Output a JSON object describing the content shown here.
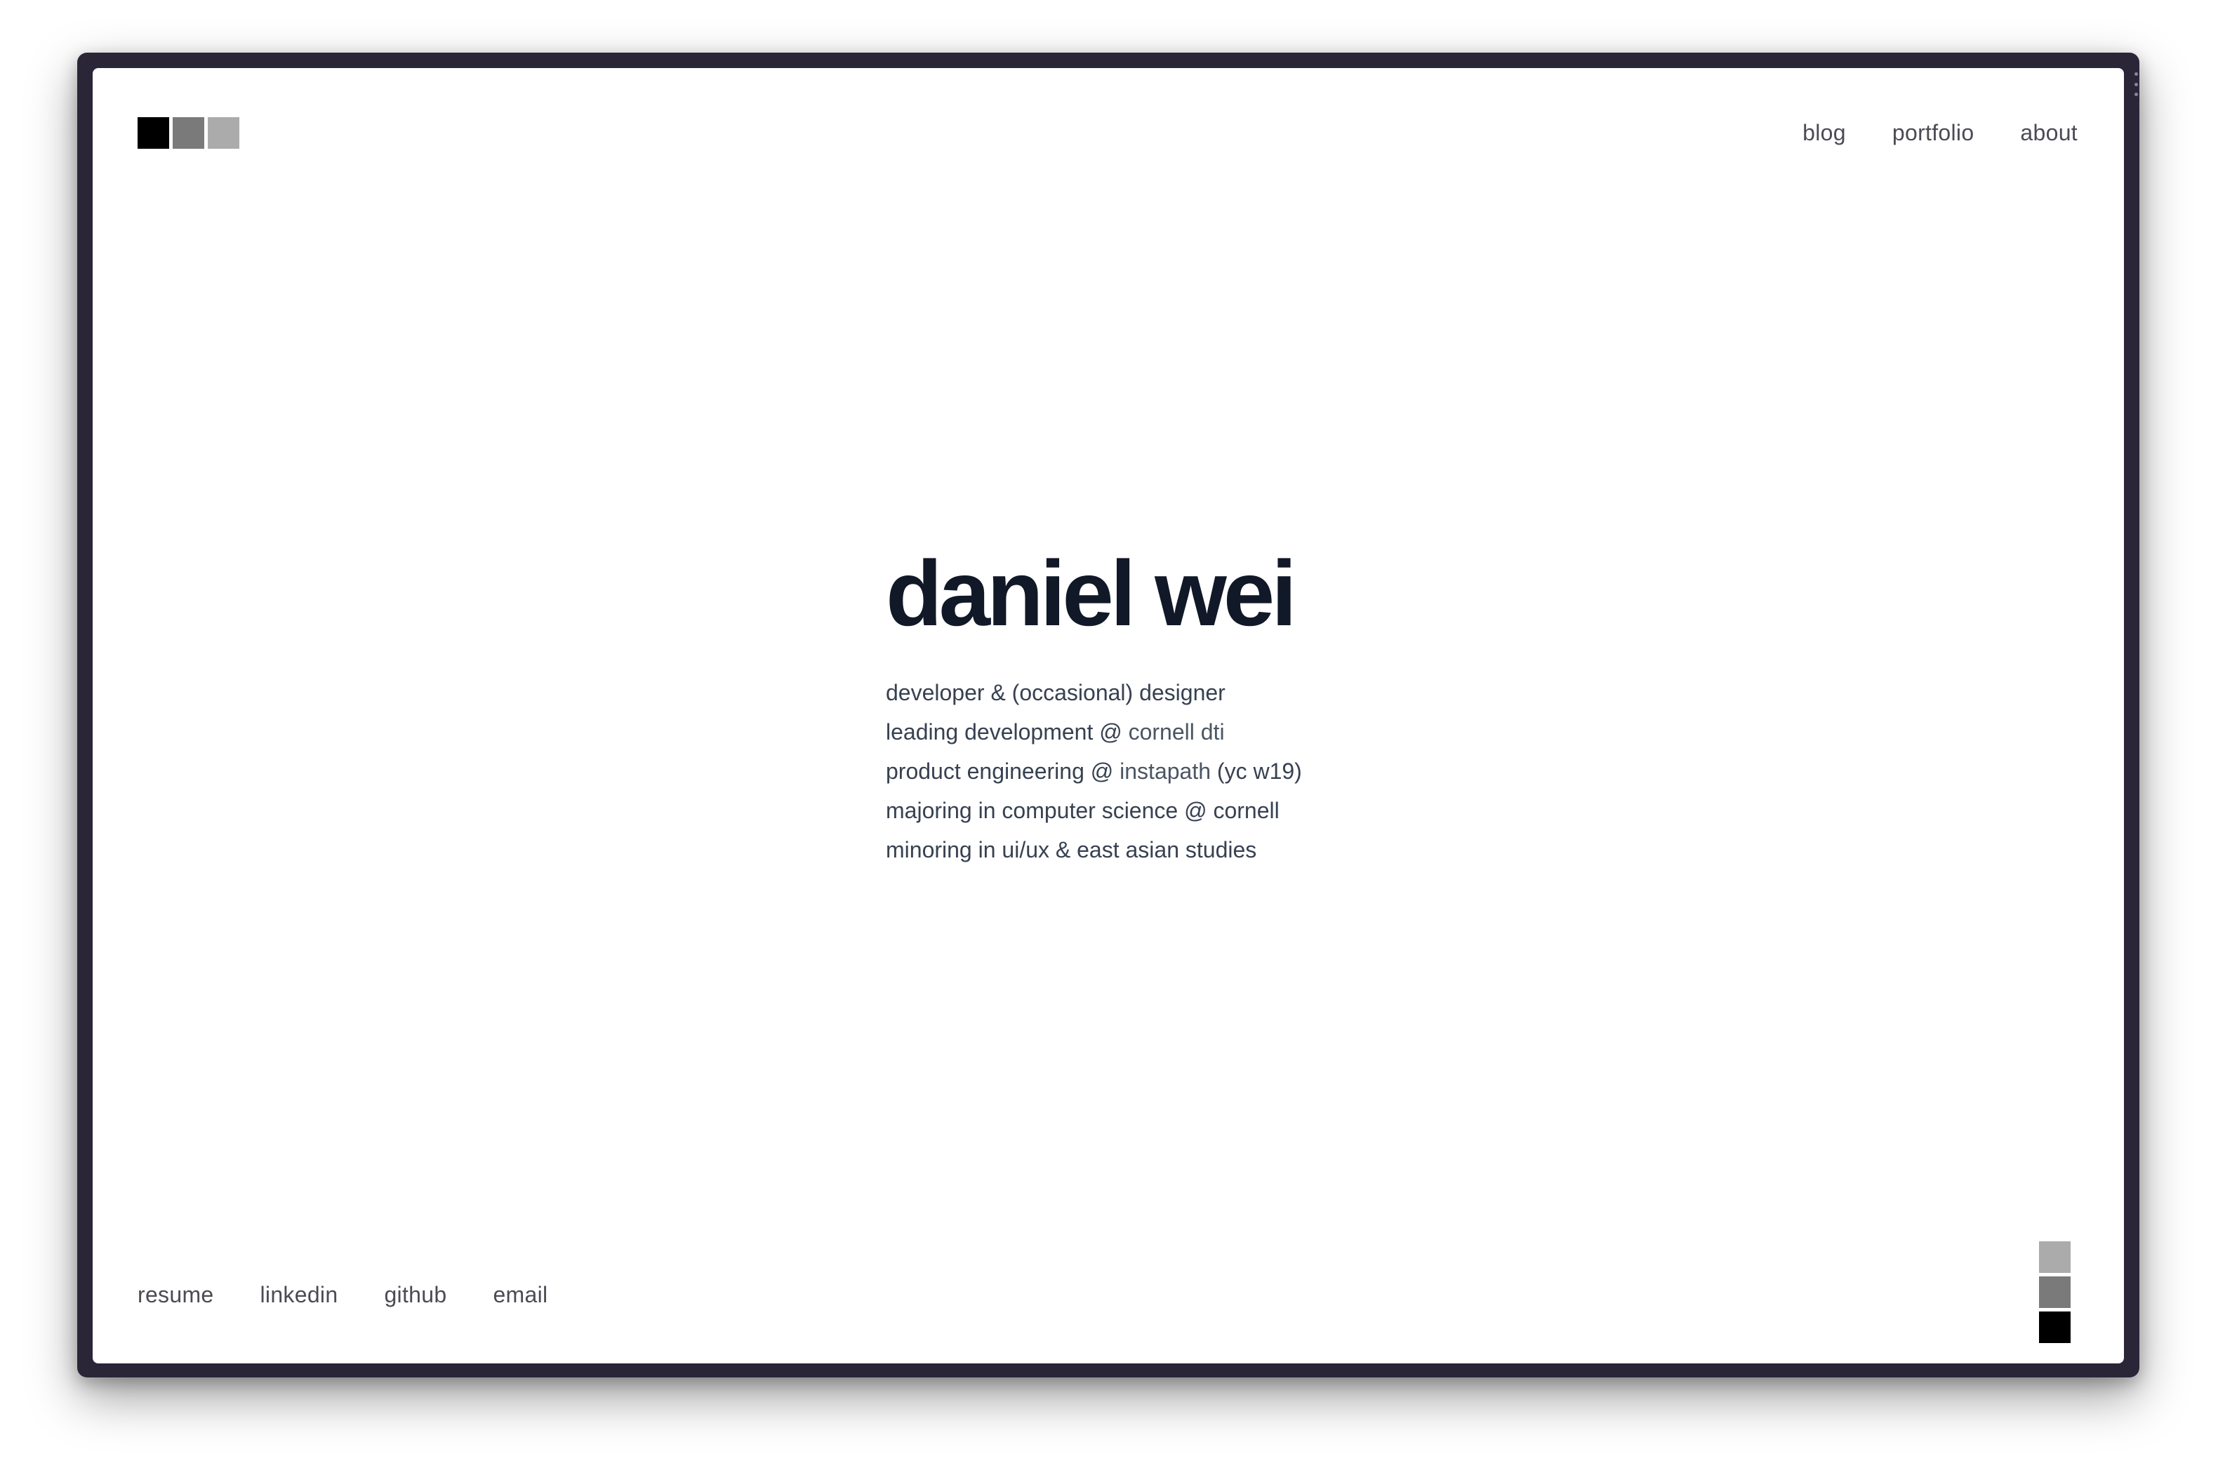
{
  "logo": {
    "colors": [
      "#000000",
      "#7a7a7a",
      "#ababab"
    ]
  },
  "nav": {
    "items": [
      {
        "label": "blog"
      },
      {
        "label": "portfolio"
      },
      {
        "label": "about"
      }
    ]
  },
  "hero": {
    "title": "daniel wei",
    "lines": {
      "line1": "developer & (occasional) designer",
      "line2_prefix": "leading development @ ",
      "line2_link": "cornell dti",
      "line3_prefix": "product engineering @ ",
      "line3_link": "instapath",
      "line3_suffix": " (yc w19)",
      "line4": "majoring in computer science @ cornell",
      "line5": "minoring in ui/ux & east asian studies"
    }
  },
  "footer": {
    "links": [
      {
        "label": "resume"
      },
      {
        "label": "linkedin"
      },
      {
        "label": "github"
      },
      {
        "label": "email"
      }
    ]
  },
  "theme_swatches": {
    "colors": [
      "#ababab",
      "#7a7a7a",
      "#000000"
    ]
  },
  "colors": {
    "frame": "#2b2538",
    "title": "#111827",
    "body_text": "#374151",
    "link_text": "#4b4b55"
  }
}
